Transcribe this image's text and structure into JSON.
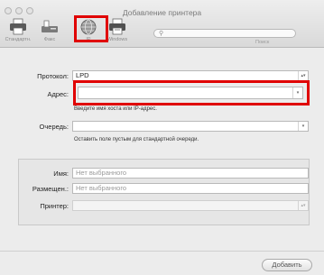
{
  "window": {
    "title": "Добавление принтера"
  },
  "toolbar": {
    "items": [
      {
        "label": "Стандартн.",
        "icon": "printer-icon"
      },
      {
        "label": "Факс",
        "icon": "fax-icon"
      },
      {
        "label": "IP",
        "icon": "globe-icon"
      },
      {
        "label": "Windows",
        "icon": "windows-printer-icon"
      }
    ],
    "search_label": "Поиск"
  },
  "form": {
    "protocol_label": "Протокол:",
    "protocol_value": "LPD",
    "address_label": "Адрес:",
    "address_value": "",
    "address_hint": "Введите имя хоста или IP-адрес.",
    "queue_label": "Очередь:",
    "queue_value": "",
    "queue_hint": "Оставить поле пустым для стандартной очереди."
  },
  "info": {
    "name_label": "Имя:",
    "name_value": "Нет выбранного",
    "location_label": "Размещен.:",
    "location_value": "Нет выбранного",
    "printer_label": "Принтер:",
    "printer_value": ""
  },
  "actions": {
    "add_label": "Добавить"
  },
  "colors": {
    "highlight": "#e00000"
  }
}
